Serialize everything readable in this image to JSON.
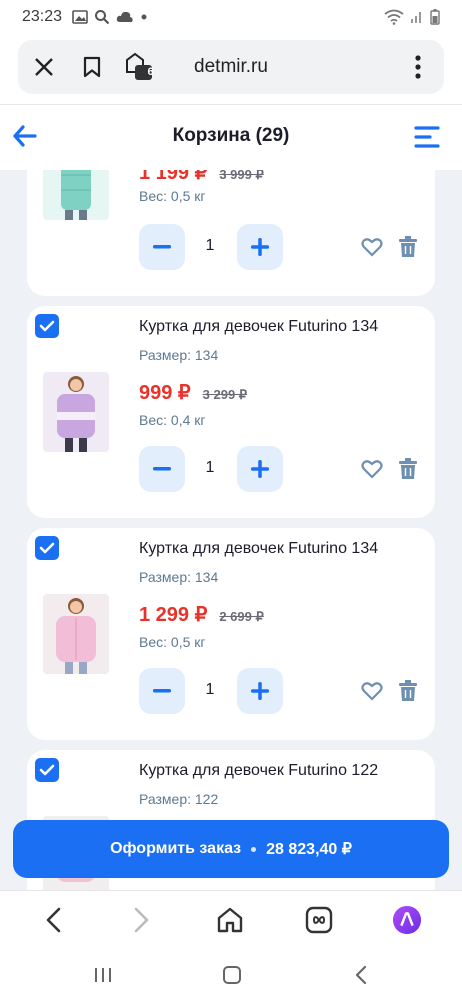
{
  "status_bar": {
    "time": "23:23"
  },
  "browser": {
    "url": "detmir.ru",
    "tabs_count": "6"
  },
  "header": {
    "title": "Корзина (29)"
  },
  "items": [
    {
      "name": "",
      "size": "",
      "price": "1 199 ₽",
      "old_price": "3 999 ₽",
      "weight": "Вес: 0,5 кг",
      "qty": "1"
    },
    {
      "name": "Куртка для девочек Futurino 134",
      "size": "Размер: 134",
      "price": "999 ₽",
      "old_price": "3 299 ₽",
      "weight": "Вес: 0,4 кг",
      "qty": "1"
    },
    {
      "name": "Куртка для девочек Futurino 134",
      "size": "Размер: 134",
      "price": "1 299 ₽",
      "old_price": "2 699 ₽",
      "weight": "Вес: 0,5 кг",
      "qty": "1"
    },
    {
      "name": "Куртка для девочек Futurino 122",
      "size": "Размер: 122",
      "price": "",
      "old_price": "",
      "weight": "",
      "qty": ""
    }
  ],
  "checkout": {
    "label": "Оформить заказ",
    "total": "28 823,40 ₽"
  },
  "colors": {
    "accent": "#1b6ff2",
    "price": "#e8322a",
    "muted": "#5d7a93"
  }
}
